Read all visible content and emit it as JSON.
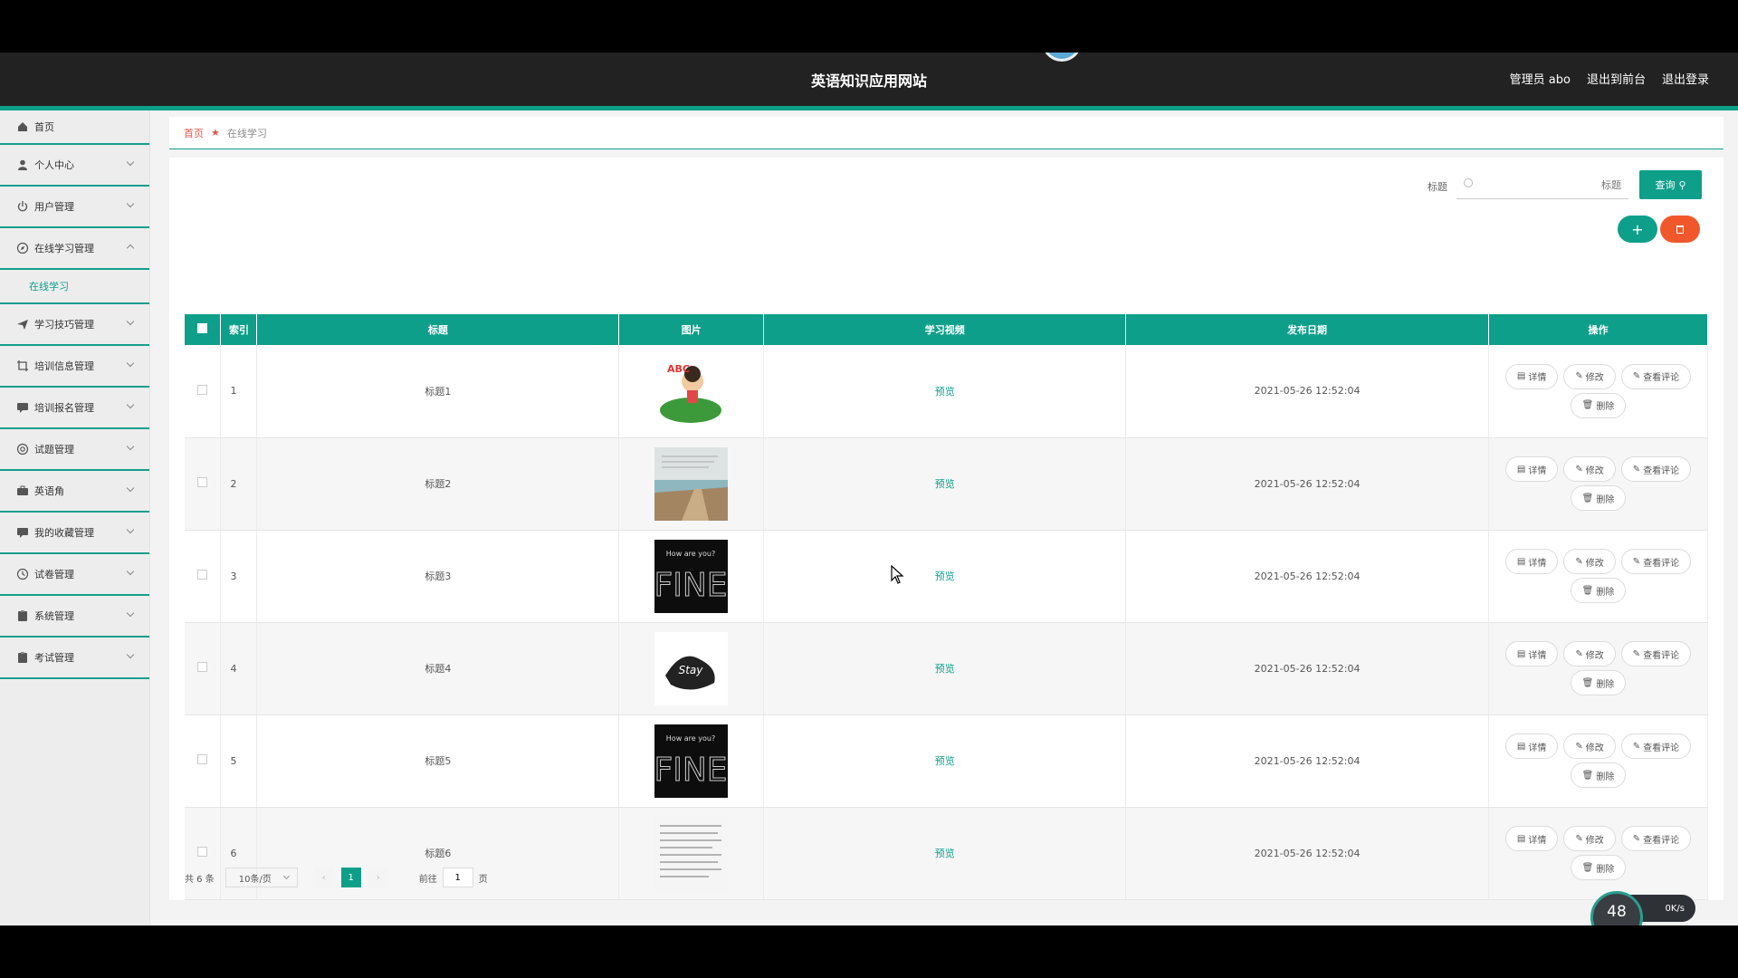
{
  "header": {
    "site_title": "英语知识应用网站",
    "admin_label": "管理员 abo",
    "back_to_front": "退出到前台",
    "logout": "退出登录"
  },
  "sidebar": {
    "items": [
      {
        "label": "首页",
        "icon": "home-icon"
      },
      {
        "label": "个人中心",
        "icon": "user-icon"
      },
      {
        "label": "用户管理",
        "icon": "power-icon"
      },
      {
        "label": "在线学习管理",
        "icon": "compass-icon",
        "expanded": true
      },
      {
        "label": "学习技巧管理",
        "icon": "send-icon"
      },
      {
        "label": "培训信息管理",
        "icon": "crop-icon"
      },
      {
        "label": "培训报名管理",
        "icon": "comment-icon"
      },
      {
        "label": "试题管理",
        "icon": "help-icon"
      },
      {
        "label": "英语角",
        "icon": "briefcase-icon"
      },
      {
        "label": "我的收藏管理",
        "icon": "comment-icon"
      },
      {
        "label": "试卷管理",
        "icon": "clock-icon"
      },
      {
        "label": "系统管理",
        "icon": "clipboard-icon"
      },
      {
        "label": "考试管理",
        "icon": "clipboard-icon"
      }
    ],
    "sub_item": "在线学习"
  },
  "breadcrumb": {
    "home": "首页",
    "current": "在线学习"
  },
  "search": {
    "label": "标题",
    "placeholder": "标题",
    "button": "查询"
  },
  "table": {
    "headers": [
      "索引",
      "标题",
      "图片",
      "学习视频",
      "发布日期",
      "操作"
    ],
    "rows": [
      {
        "index": "1",
        "title": "标题1",
        "video": "预览",
        "date": "2021-05-26 12:52:04",
        "image": "cartoon"
      },
      {
        "index": "2",
        "title": "标题2",
        "video": "预览",
        "date": "2021-05-26 12:52:04",
        "image": "beach"
      },
      {
        "index": "3",
        "title": "标题3",
        "video": "预览",
        "date": "2021-05-26 12:52:04",
        "image": "fine"
      },
      {
        "index": "4",
        "title": "标题4",
        "video": "预览",
        "date": "2021-05-26 12:52:04",
        "image": "lettering"
      },
      {
        "index": "5",
        "title": "标题5",
        "video": "预览",
        "date": "2021-05-26 12:52:04",
        "image": "fine"
      },
      {
        "index": "6",
        "title": "标题6",
        "video": "预览",
        "date": "2021-05-26 12:52:04",
        "image": "document"
      }
    ],
    "ops": {
      "detail": "详情",
      "edit": "修改",
      "comments": "查看评论",
      "delete": "删除"
    }
  },
  "pagination": {
    "total": "共 6 条",
    "page_size": "10条/页",
    "current_page": "1",
    "goto_prefix": "前往",
    "goto_value": "1",
    "goto_suffix": "页"
  },
  "net_widget": {
    "percent": "48",
    "speed": "0K/s"
  },
  "colors": {
    "accent": "#0e9f8a",
    "danger": "#f0582b",
    "header_bg": "#222222"
  }
}
